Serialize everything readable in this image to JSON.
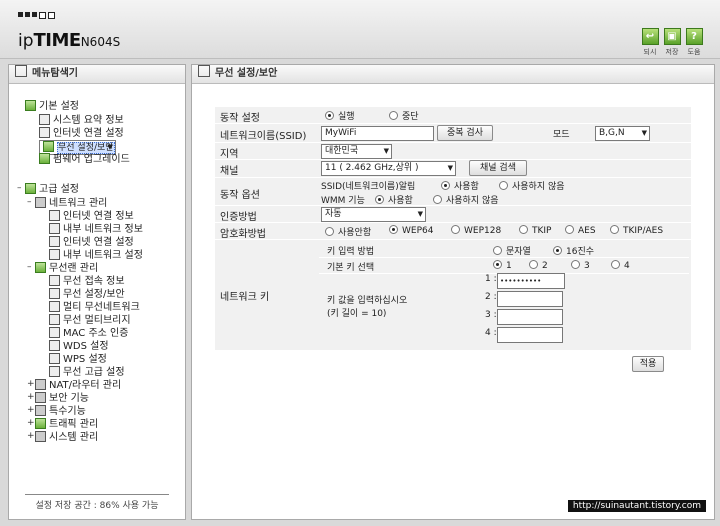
{
  "header": {
    "logo_prefix": "ip",
    "logo_brand": "TIME",
    "logo_model": "N604S",
    "buttons": [
      {
        "label": "되시",
        "icon": "exit-icon",
        "glyph": "↩"
      },
      {
        "label": "저장",
        "icon": "save-icon",
        "glyph": "▣"
      },
      {
        "label": "도움",
        "icon": "help-icon",
        "glyph": "?"
      }
    ]
  },
  "sidebar": {
    "title": "메뉴탐색기",
    "basic": {
      "label": "기본 설정",
      "items": [
        "시스템 요약 정보",
        "인터넷 연결 설정",
        "무선 설정/보안",
        "펌웨어 업그레이드"
      ]
    },
    "advanced": {
      "label": "고급 설정",
      "network": {
        "label": "네트워크 관리",
        "items": [
          "인터넷 연결 정보",
          "내부 네트워크 정보",
          "인터넷 연결 설정",
          "내부 네트워크 설정"
        ]
      },
      "wireless": {
        "label": "무선랜 관리",
        "items": [
          "무선 접속 정보",
          "무선 설정/보안",
          "멀티 무선네트워크",
          "무선 멀티브리지",
          "MAC 주소 인증",
          "WDS 설정",
          "WPS 설정",
          "무선 고급 설정"
        ]
      },
      "others": [
        "NAT/라우터 관리",
        "보안 기능",
        "특수기능",
        "트래픽 관리",
        "시스템 관리"
      ]
    },
    "storage": "설정 저장 공간 : 86% 사용 가능"
  },
  "main": {
    "title": "무선 설정/보안",
    "op_label": "동작 설정",
    "op_run": "실행",
    "op_stop": "중단",
    "ssid_label": "네트워크이름(SSID)",
    "ssid_value": "MyWiFi",
    "dup_check": "중복 검사",
    "mode_label": "모드",
    "mode_value": "B,G,N",
    "region_label": "지역",
    "region_value": "대한민국",
    "channel_label": "채널",
    "channel_value": "11 ( 2.462 GHz,상위 )",
    "channel_search": "채널 검색",
    "opt_label": "동작 옵션",
    "ssid_broadcast": "SSID(네트워크이름)알림",
    "wmm": "WMM 기능",
    "use": "사용함",
    "nouse": "사용하지 않음",
    "auth_label": "인증방법",
    "auth_value": "자동",
    "enc_label": "암호화방법",
    "enc_options": [
      "사용안함",
      "WEP64",
      "WEP128",
      "TKIP",
      "AES",
      "TKIP/AES"
    ],
    "netkey_label": "네트워크 키",
    "key_input_label": "키 입력 방법",
    "key_input_text": "문자열",
    "key_input_hex": "16진수",
    "default_key_label": "기본 키 선택",
    "key_numbers": [
      "1",
      "2",
      "3",
      "4"
    ],
    "key_prompt": "키 값을 입력하십시오",
    "key_length": "(키 길이 = 10)",
    "key_rows": [
      "1 :",
      "2 :",
      "3 :",
      "4 :"
    ],
    "key1_value": "••••••••••",
    "apply": "적용"
  },
  "watermark": "http://suinautant.tistory.com"
}
